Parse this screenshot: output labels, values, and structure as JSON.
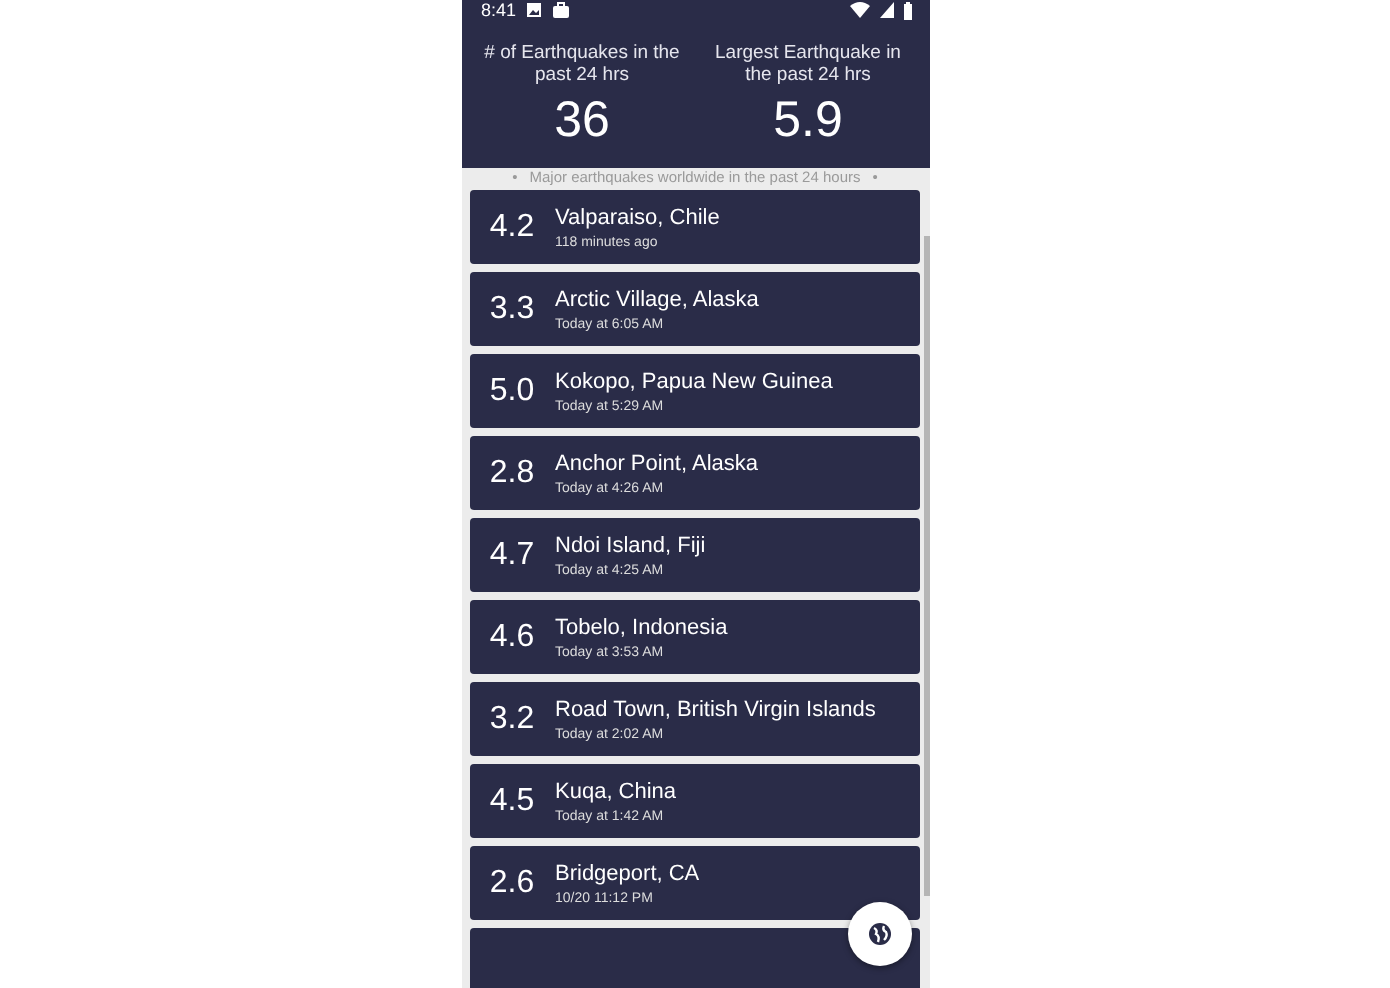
{
  "status_bar": {
    "time": "8:41"
  },
  "summary": [
    {
      "label": "# of Earthquakes in the past 24 hrs",
      "value": "36"
    },
    {
      "label": "Largest Earthquake in the past 24 hrs",
      "value": "5.9"
    }
  ],
  "subtitle": {
    "bullet_left": "•",
    "text": "Major earthquakes worldwide in the past 24 hours",
    "bullet_right": "•"
  },
  "quakes": [
    {
      "magnitude": "4.2",
      "place": "Valparaiso, Chile",
      "time": "118 minutes ago"
    },
    {
      "magnitude": "3.3",
      "place": "Arctic Village, Alaska",
      "time": "Today at 6:05 AM"
    },
    {
      "magnitude": "5.0",
      "place": "Kokopo, Papua New Guinea",
      "time": "Today at 5:29 AM"
    },
    {
      "magnitude": "2.8",
      "place": "Anchor Point, Alaska",
      "time": "Today at 4:26 AM"
    },
    {
      "magnitude": "4.7",
      "place": "Ndoi Island, Fiji",
      "time": "Today at 4:25 AM"
    },
    {
      "magnitude": "4.6",
      "place": "Tobelo, Indonesia",
      "time": "Today at 3:53 AM"
    },
    {
      "magnitude": "3.2",
      "place": "Road Town, British Virgin Islands",
      "time": "Today at 2:02 AM"
    },
    {
      "magnitude": "4.5",
      "place": "Kuqa, China",
      "time": "Today at 1:42 AM"
    },
    {
      "magnitude": "2.6",
      "place": "Bridgeport, CA",
      "time": "10/20 11:12 PM"
    }
  ]
}
